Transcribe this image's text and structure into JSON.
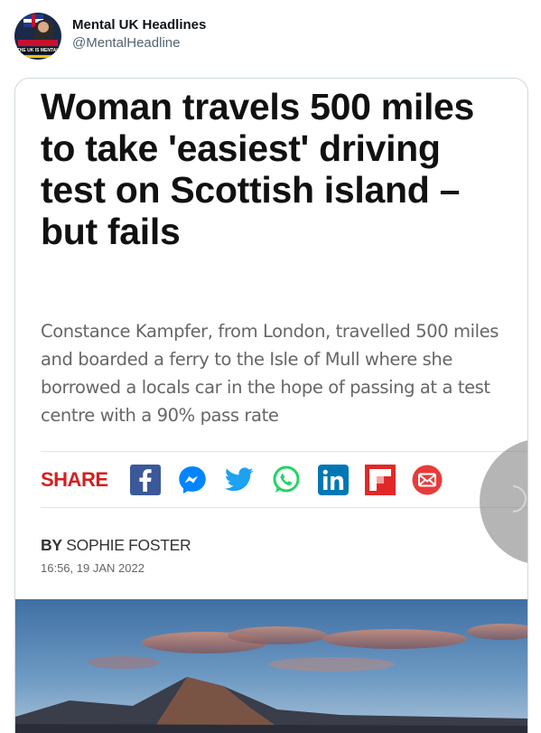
{
  "tweet": {
    "display_name": "Mental UK Headlines",
    "handle": "@MentalHeadline",
    "avatar_text": "THE UK IS MENTAL"
  },
  "article": {
    "headline": "Woman travels 500 miles to take 'easiest' driving test on Scottish island – but fails",
    "summary": "Constance Kampfer, from London, travelled 500 miles and boarded a ferry to the Isle of Mull where she borrowed a locals car in the hope of passing at a test centre with a 90% pass rate",
    "share_label": "SHARE",
    "share_icons": [
      "facebook-icon",
      "messenger-icon",
      "twitter-icon",
      "whatsapp-icon",
      "linkedin-icon",
      "flipboard-icon",
      "email-icon"
    ],
    "by_prefix": "BY",
    "author": "SOPHIE FOSTER",
    "dateline": "16:56, 19 JAN 2022"
  },
  "colors": {
    "share_red": "#d41f1f",
    "facebook": "#3b5998",
    "messenger": "#0084ff",
    "twitter": "#1da1f2",
    "whatsapp": "#25d366",
    "linkedin": "#0077b5",
    "flipboard": "#e12828",
    "email": "#e83b3b"
  }
}
